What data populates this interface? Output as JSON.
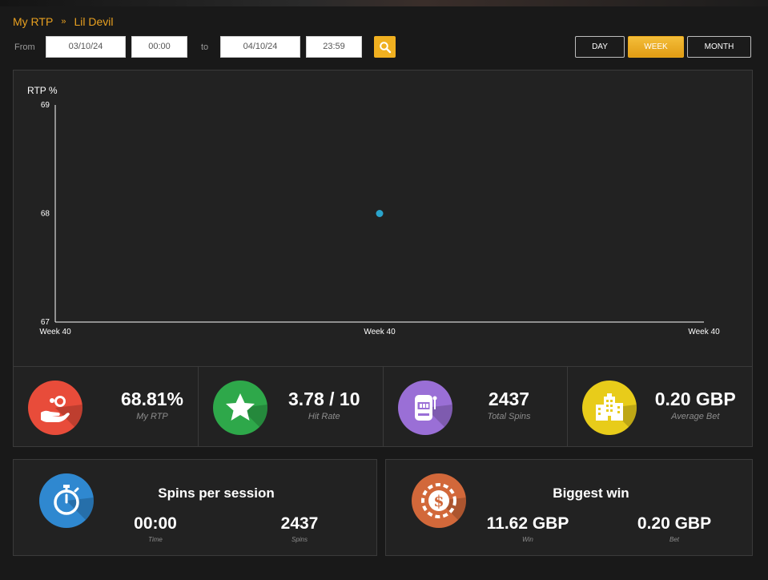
{
  "breadcrumb": {
    "root": "My RTP",
    "separator": "»",
    "current": "Lil Devil"
  },
  "filters": {
    "from_label": "From",
    "from_date": "03/10/24",
    "from_time": "00:00",
    "to_label": "to",
    "to_date": "04/10/24",
    "to_time": "23:59"
  },
  "periods": [
    {
      "label": "DAY",
      "active": false
    },
    {
      "label": "WEEK",
      "active": true
    },
    {
      "label": "MONTH",
      "active": false
    }
  ],
  "chart_data": {
    "type": "scatter",
    "ylabel": "RTP %",
    "ylim": [
      67,
      69
    ],
    "yticks": [
      "69",
      "68",
      "67"
    ],
    "x_tick_labels": [
      "Week 40",
      "Week 40",
      "Week 40"
    ],
    "series": [
      {
        "points": [
          {
            "x": "Week 40",
            "y": 68
          }
        ]
      }
    ],
    "point_color": "#2aa4cc"
  },
  "stats": [
    {
      "value": "68.81%",
      "label": "My RTP",
      "icon": "money-hand-icon",
      "color": "#e84c3a"
    },
    {
      "value": "3.78 / 10",
      "label": "Hit Rate",
      "icon": "star-icon",
      "color": "#2ea84a"
    },
    {
      "value": "2437",
      "label": "Total Spins",
      "icon": "slot-machine-icon",
      "color": "#9a6fd6"
    },
    {
      "value": "0.20 GBP",
      "label": "Average Bet",
      "icon": "building-icon",
      "color": "#e8cc1a"
    }
  ],
  "session": {
    "title": "Spins per session",
    "time_value": "00:00",
    "time_label": "Time",
    "spins_value": "2437",
    "spins_label": "Spins",
    "icon": "stopwatch-icon",
    "color": "#2f88d0"
  },
  "biggest": {
    "title": "Biggest win",
    "win_value": "11.62 GBP",
    "win_label": "Win",
    "bet_value": "0.20 GBP",
    "bet_label": "Bet",
    "icon": "casino-chip-icon",
    "color": "#d2683a"
  }
}
